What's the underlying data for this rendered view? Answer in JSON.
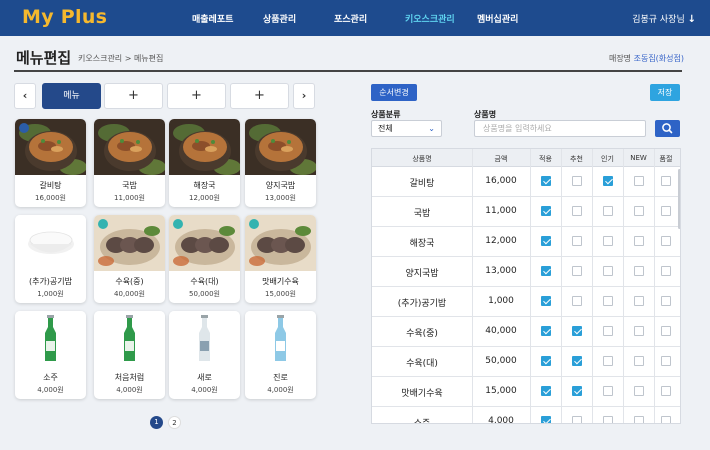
{
  "app": {
    "logo": "My Plus",
    "user": "김봉규 사장님"
  },
  "nav": [
    "매출레포트",
    "상품관리",
    "포스관리",
    "키오스크관리",
    "멤버십관리"
  ],
  "nav_active": "키오스크관리",
  "page": {
    "title": "메뉴편집",
    "breadcrumb": "키오스크관리 > 메뉴편집",
    "store_label": "매장명",
    "store_name": "조동집(화성점)"
  },
  "category_tabs": {
    "prev": "‹",
    "next": "›",
    "items": [
      "메뉴",
      "+",
      "+",
      "+",
      "+"
    ]
  },
  "menu_cards": [
    {
      "name": "갈비탕",
      "price": "16,000원",
      "badge": "best",
      "icon": "soup-bowl-icon"
    },
    {
      "name": "국밥",
      "price": "11,000원",
      "badge": "",
      "icon": "soup-bowl-icon"
    },
    {
      "name": "해장국",
      "price": "12,000원",
      "badge": "",
      "icon": "soup-bowl-icon"
    },
    {
      "name": "양지국밥",
      "price": "13,000원",
      "badge": "",
      "icon": "soup-bowl-icon"
    },
    {
      "name": "(추가)공기밥",
      "price": "1,000원",
      "badge": "",
      "icon": "rice-bowl-icon"
    },
    {
      "name": "수육(중)",
      "price": "40,000원",
      "badge": "rec",
      "icon": "sliced-meat-icon"
    },
    {
      "name": "수육(대)",
      "price": "50,000원",
      "badge": "rec",
      "icon": "sliced-meat-icon"
    },
    {
      "name": "맛배기수육",
      "price": "15,000원",
      "badge": "rec",
      "icon": "sliced-meat-icon"
    },
    {
      "name": "소주",
      "price": "4,000원",
      "badge": "",
      "icon": "green-bottle-icon"
    },
    {
      "name": "처음처럼",
      "price": "4,000원",
      "badge": "",
      "icon": "green-bottle-icon"
    },
    {
      "name": "새로",
      "price": "4,000원",
      "badge": "",
      "icon": "clear-bottle-icon"
    },
    {
      "name": "진로",
      "price": "4,000원",
      "badge": "",
      "icon": "blue-bottle-icon"
    }
  ],
  "pagination": {
    "pages": [
      "1",
      "2"
    ],
    "current": "1"
  },
  "right": {
    "order_button": "순서변경",
    "save_button": "저장",
    "category_label": "상품분류",
    "category_value": "전체",
    "name_label": "상품명",
    "name_placeholder": "상품명을 입력하세요"
  },
  "table": {
    "headers": [
      "상품명",
      "금액",
      "적용",
      "추천",
      "인기",
      "NEW",
      "품절"
    ],
    "rows": [
      {
        "name": "갈비탕",
        "price": "16,000",
        "apply": true,
        "rec": false,
        "pop": true,
        "new": false,
        "sold": false
      },
      {
        "name": "국밥",
        "price": "11,000",
        "apply": true,
        "rec": false,
        "pop": false,
        "new": false,
        "sold": false
      },
      {
        "name": "해장국",
        "price": "12,000",
        "apply": true,
        "rec": false,
        "pop": false,
        "new": false,
        "sold": false
      },
      {
        "name": "양지국밥",
        "price": "13,000",
        "apply": true,
        "rec": false,
        "pop": false,
        "new": false,
        "sold": false
      },
      {
        "name": "(추가)공기밥",
        "price": "1,000",
        "apply": true,
        "rec": false,
        "pop": false,
        "new": false,
        "sold": false
      },
      {
        "name": "수육(중)",
        "price": "40,000",
        "apply": true,
        "rec": true,
        "pop": false,
        "new": false,
        "sold": false
      },
      {
        "name": "수육(대)",
        "price": "50,000",
        "apply": true,
        "rec": true,
        "pop": false,
        "new": false,
        "sold": false
      },
      {
        "name": "맛배기수육",
        "price": "15,000",
        "apply": true,
        "rec": true,
        "pop": false,
        "new": false,
        "sold": false
      },
      {
        "name": "소주",
        "price": "4,000",
        "apply": true,
        "rec": false,
        "pop": false,
        "new": false,
        "sold": false
      }
    ]
  },
  "colors": {
    "nav_bg": "#1e4b8e",
    "logo": "#f5b82e",
    "active_nav": "#5fd3f0",
    "primary": "#2e63c6",
    "check": "#2a9fd8"
  }
}
